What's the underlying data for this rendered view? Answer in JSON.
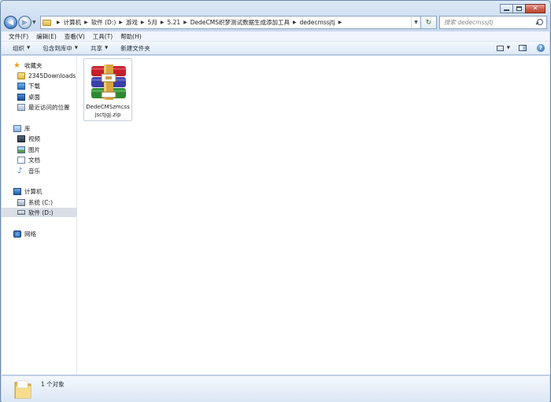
{
  "window": {
    "caption": {
      "minimize_icon": "minimize-icon",
      "maximize_icon": "maximize-icon",
      "close_glyph": "✕"
    }
  },
  "address_bar": {
    "breadcrumbs": [
      "计算机",
      "软件 (D:)",
      "游戏",
      "5月",
      "5.21",
      "DedeCMS织梦测试数据生成添加工具",
      "dedecmssjtj"
    ],
    "search_placeholder": "搜索 dedecmssjtj"
  },
  "menubar": {
    "items": [
      "文件(F)",
      "编辑(E)",
      "查看(V)",
      "工具(T)",
      "帮助(H)"
    ]
  },
  "commandbar": {
    "organize": "组织",
    "include_in_library": "包含到库中",
    "share": "共享",
    "new_folder": "新建文件夹"
  },
  "navpane": {
    "favorites": {
      "label": "收藏夹",
      "items": [
        "2345Downloads",
        "下载",
        "桌面",
        "最近访问的位置"
      ]
    },
    "libraries": {
      "label": "库",
      "items": [
        "视频",
        "图片",
        "文档",
        "音乐"
      ]
    },
    "computer": {
      "label": "计算机",
      "items": [
        "系统 (C:)",
        "软件 (D:)"
      ],
      "selected": "软件 (D:)"
    },
    "network": {
      "label": "网络"
    }
  },
  "files": [
    {
      "name": "DedeCMSzmcssjsctjgj.zip",
      "display_lines": [
        "DedeCMSzmcss",
        "jsctjgj.zip"
      ],
      "icon": "winrar-archive-icon"
    }
  ],
  "details": {
    "count": "1 个对象"
  },
  "colors": {
    "window_frame": "#c7d9ee",
    "selection": "#dadfe6",
    "archive_red": "#c21f2a",
    "archive_blue": "#3b3fa6",
    "archive_green": "#2e8a32"
  }
}
